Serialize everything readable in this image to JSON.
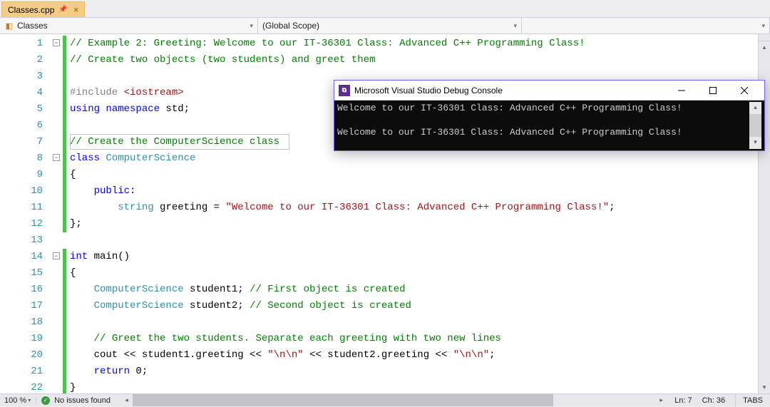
{
  "tab": {
    "filename": "Classes.cpp"
  },
  "dropdowns": {
    "class": "Classes",
    "scope": "(Global Scope)",
    "member": ""
  },
  "code": {
    "lines": [
      {
        "n": 1,
        "segs": [
          {
            "t": "// Example 2: Greeting: Welcome to our IT-36301 Class: Advanced C++ Programming Class!",
            "c": "c-comment"
          }
        ]
      },
      {
        "n": 2,
        "segs": [
          {
            "t": "// Create two objects (two students) and greet them",
            "c": "c-comment"
          }
        ]
      },
      {
        "n": 3,
        "segs": []
      },
      {
        "n": 4,
        "segs": [
          {
            "t": "#include ",
            "c": "c-include"
          },
          {
            "t": "<iostream>",
            "c": "c-includefile"
          }
        ]
      },
      {
        "n": 5,
        "segs": [
          {
            "t": "using",
            "c": "c-keyword"
          },
          {
            "t": " "
          },
          {
            "t": "namespace",
            "c": "c-keyword"
          },
          {
            "t": " std;"
          }
        ]
      },
      {
        "n": 6,
        "segs": []
      },
      {
        "n": 7,
        "segs": [
          {
            "t": "// Create the ComputerScience class",
            "c": "c-comment"
          }
        ]
      },
      {
        "n": 8,
        "segs": [
          {
            "t": "class",
            "c": "c-keyword"
          },
          {
            "t": " "
          },
          {
            "t": "ComputerScience",
            "c": "c-type"
          }
        ]
      },
      {
        "n": 9,
        "segs": [
          {
            "t": "{"
          }
        ]
      },
      {
        "n": 10,
        "segs": [
          {
            "t": "    "
          },
          {
            "t": "public",
            "c": "c-keyword"
          },
          {
            "t": ":"
          }
        ]
      },
      {
        "n": 11,
        "segs": [
          {
            "t": "        "
          },
          {
            "t": "string",
            "c": "c-type"
          },
          {
            "t": " greeting = "
          },
          {
            "t": "\"Welcome to our IT-36301 Class: Advanced C++ Programming Class!\"",
            "c": "c-string"
          },
          {
            "t": ";"
          }
        ]
      },
      {
        "n": 12,
        "segs": [
          {
            "t": "};"
          }
        ]
      },
      {
        "n": 13,
        "segs": []
      },
      {
        "n": 14,
        "segs": [
          {
            "t": "int",
            "c": "c-keyword"
          },
          {
            "t": " main()"
          }
        ]
      },
      {
        "n": 15,
        "segs": [
          {
            "t": "{"
          }
        ]
      },
      {
        "n": 16,
        "segs": [
          {
            "t": "    "
          },
          {
            "t": "ComputerScience",
            "c": "c-type"
          },
          {
            "t": " student1; "
          },
          {
            "t": "// First object is created",
            "c": "c-comment"
          }
        ]
      },
      {
        "n": 17,
        "segs": [
          {
            "t": "    "
          },
          {
            "t": "ComputerScience",
            "c": "c-type"
          },
          {
            "t": " student2; "
          },
          {
            "t": "// Second object is created",
            "c": "c-comment"
          }
        ]
      },
      {
        "n": 18,
        "segs": []
      },
      {
        "n": 19,
        "segs": [
          {
            "t": "    "
          },
          {
            "t": "// Greet the two students. Separate each greeting with two new lines",
            "c": "c-comment"
          }
        ]
      },
      {
        "n": 20,
        "segs": [
          {
            "t": "    cout << student1.greeting << "
          },
          {
            "t": "\"\\n\\n\"",
            "c": "c-string"
          },
          {
            "t": " << student2.greeting << "
          },
          {
            "t": "\"\\n\\n\"",
            "c": "c-string"
          },
          {
            "t": ";"
          }
        ]
      },
      {
        "n": 21,
        "segs": [
          {
            "t": "    "
          },
          {
            "t": "return",
            "c": "c-keyword"
          },
          {
            "t": " 0;"
          }
        ]
      },
      {
        "n": 22,
        "segs": [
          {
            "t": "}"
          }
        ]
      }
    ]
  },
  "status": {
    "zoom": "100 %",
    "issues": "No issues found",
    "line_label": "Ln: 7",
    "col_label": "Ch: 36",
    "tabs_label": "TABS"
  },
  "console": {
    "title": "Microsoft Visual Studio Debug Console",
    "output": "Welcome to our IT-36301 Class: Advanced C++ Programming Class!\n\nWelcome to our IT-36301 Class: Advanced C++ Programming Class!\n"
  }
}
